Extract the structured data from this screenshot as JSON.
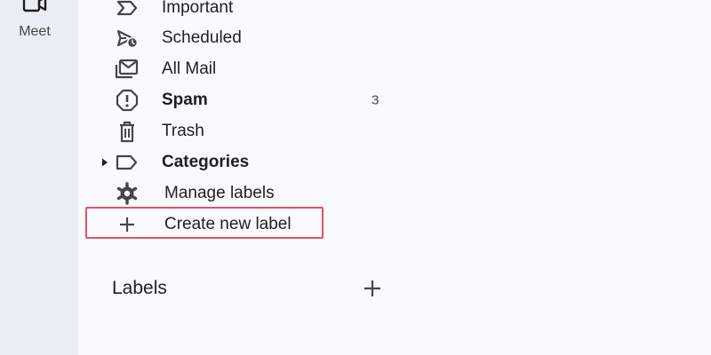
{
  "rail": {
    "meet_label": "Meet"
  },
  "nav": {
    "items": [
      {
        "label": "Important",
        "icon": "important-icon"
      },
      {
        "label": "Scheduled",
        "icon": "scheduled-icon"
      },
      {
        "label": "All Mail",
        "icon": "all-mail-icon"
      },
      {
        "label": "Spam",
        "icon": "spam-icon",
        "count": "3",
        "bold": true
      },
      {
        "label": "Trash",
        "icon": "trash-icon"
      },
      {
        "label": "Categories",
        "icon": "label-icon",
        "bold": true,
        "expandable": true
      },
      {
        "label": "Manage labels",
        "icon": "gear-icon"
      },
      {
        "label": "Create new label",
        "icon": "plus-icon",
        "highlighted": true
      }
    ]
  },
  "labels_section": {
    "title": "Labels",
    "add_icon": "plus-icon"
  },
  "colors": {
    "rail_bg": "#e9eef6",
    "main_bg": "#f8fafd",
    "text": "#1f1f1f",
    "icon": "#444746",
    "highlight_border": "#e0565b"
  }
}
